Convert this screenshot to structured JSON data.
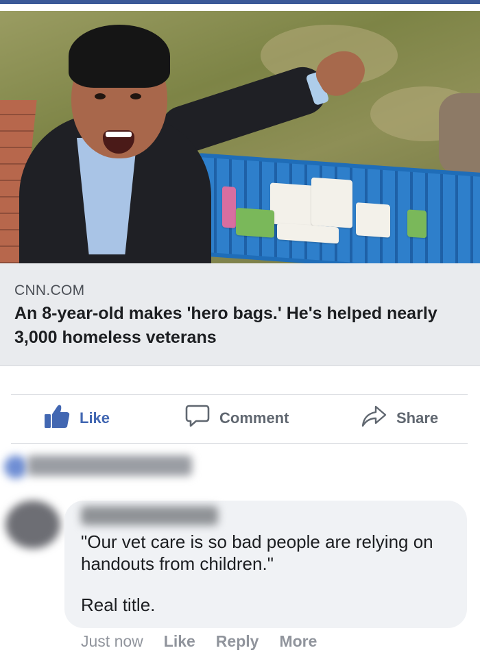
{
  "post": {
    "link_preview": {
      "domain": "CNN.COM",
      "headline": "An 8-year-old makes 'hero bags.' He's helped nearly 3,000 homeless veterans"
    },
    "actions": {
      "like": "Like",
      "comment": "Comment",
      "share": "Share"
    }
  },
  "comment": {
    "text_line1": "\"Our vet care is so bad people are relying on handouts from children.\"",
    "text_line2": "Real title.",
    "timestamp": "Just now",
    "like": "Like",
    "reply": "Reply",
    "more": "More"
  },
  "colors": {
    "brand_blue": "#4267b2",
    "top_bar": "#3b5998",
    "preview_bg": "#e9ebee",
    "bubble_bg": "#f0f2f5"
  },
  "icons": [
    "like-thumb-icon",
    "comment-bubble-icon",
    "share-arrow-icon"
  ]
}
